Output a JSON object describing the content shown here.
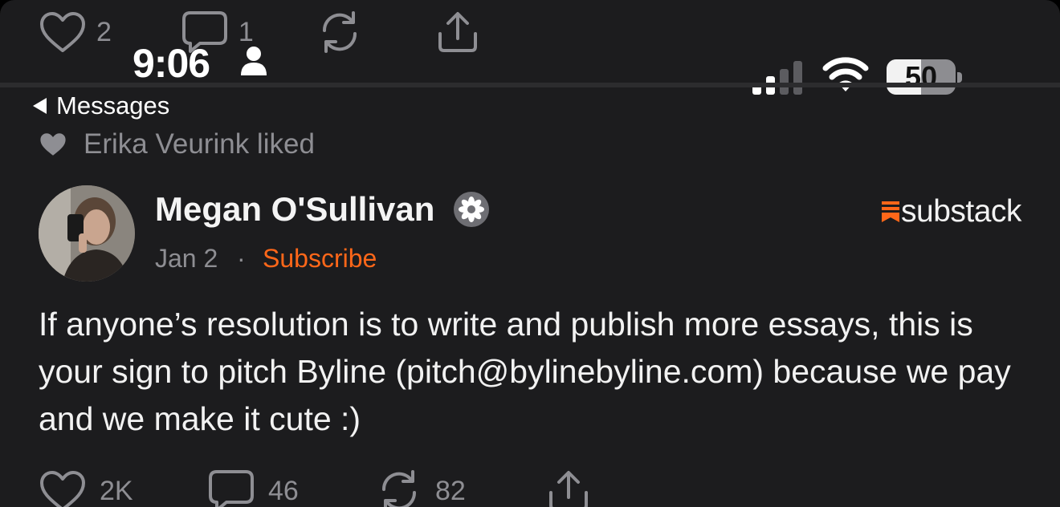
{
  "prev_post": {
    "likes": "2",
    "comments": "1"
  },
  "status_bar": {
    "time": "9:06",
    "battery": "50",
    "battery_level": 0.5
  },
  "nav": {
    "back_label": "Messages"
  },
  "context": {
    "liked_by": "Erika Veurink liked"
  },
  "post": {
    "author": "Megan O'Sullivan",
    "date": "Jan 2",
    "separator": "·",
    "subscribe_label": "Subscribe",
    "brand": "substack",
    "body": "If anyone’s resolution is to write and publish more essays, this is your sign to pitch Byline (pitch@bylinebyline.com) because we pay and we make it cute :)",
    "likes": "2K",
    "comments": "46",
    "restacks": "82"
  },
  "colors": {
    "accent": "#ff6719",
    "background": "#1c1c1e",
    "muted": "#8e8e93"
  },
  "icons": [
    "heart-icon",
    "comment-icon",
    "restack-icon",
    "share-icon",
    "person-icon",
    "signal-icon",
    "wifi-icon",
    "battery-icon",
    "back-arrow-icon",
    "verified-badge-icon",
    "substack-logo-icon"
  ]
}
